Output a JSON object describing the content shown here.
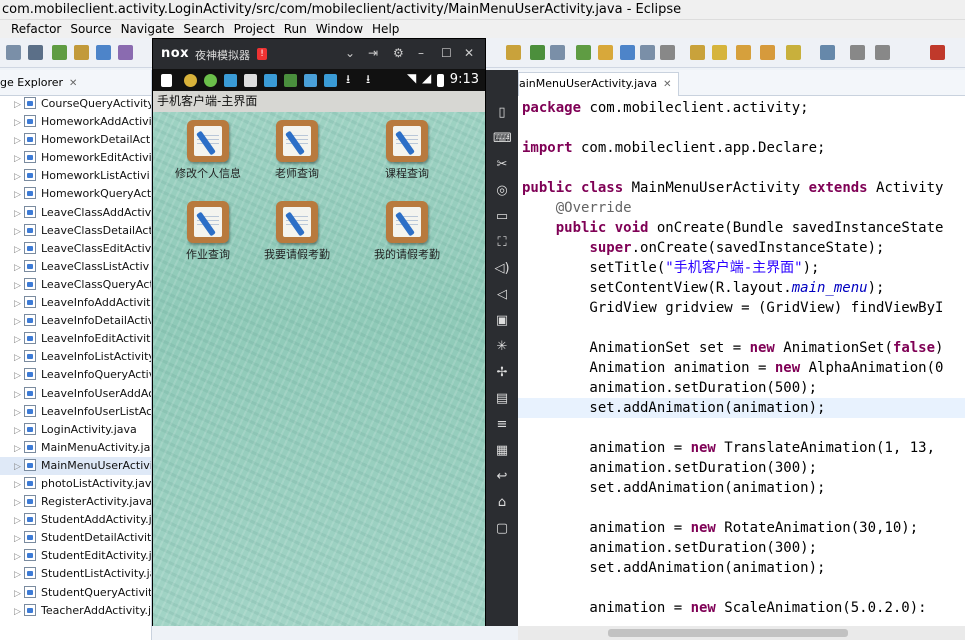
{
  "window": {
    "title": "com.mobileclient.activity.LoginActivity/src/com/mobileclient/activity/MainMenuUserActivity.java - Eclipse"
  },
  "menu": [
    "Refactor",
    "Source",
    "Navigate",
    "Search",
    "Project",
    "Run",
    "Window",
    "Help"
  ],
  "package_explorer": {
    "tab_label": "ge Explorer",
    "items": [
      "CourseQueryActivity.j",
      "HomeworkAddActivi",
      "HomeworkDetailActi",
      "HomeworkEditActivi",
      "HomeworkListActivi",
      "HomeworkQueryAct",
      "LeaveClassAddActiv",
      "LeaveClassDetailActi",
      "LeaveClassEditActiv",
      "LeaveClassListActiv",
      "LeaveClassQueryActi",
      "LeaveInfoAddActivit",
      "LeaveInfoDetailActiv",
      "LeaveInfoEditActivit",
      "LeaveInfoListActivity.",
      "LeaveInfoQueryActiv",
      "LeaveInfoUserAddAc",
      "LeaveInfoUserListAct",
      "LoginActivity.java",
      "MainMenuActivity.jav",
      "MainMenuUserActivi",
      "photoListActivity.java",
      "RegisterActivity.java",
      "StudentAddActivity.ja",
      "StudentDetailActivity.",
      "StudentEditActivity.ja",
      "StudentListActivity.jav",
      "StudentQueryActivity.",
      "TeacherAddActivity.ja"
    ],
    "selected_index": 20
  },
  "emulator": {
    "logo": "nox",
    "title": "夜神模拟器",
    "badge": "!",
    "controls": {
      "dropdown": "⌄",
      "pin": "⇥",
      "settings": "⚙",
      "minimize": "–",
      "maximize": "☐",
      "close": "✕"
    },
    "status_time": "9:13",
    "app_title": "手机客户端-主界面",
    "grid": [
      {
        "label": "修改个人信息"
      },
      {
        "label": "老师查询"
      },
      {
        "label": "课程查询"
      },
      {
        "label": "作业查询"
      },
      {
        "label": "我要请假考勤"
      },
      {
        "label": "我的请假考勤"
      }
    ]
  },
  "side_toolbar": [
    "phone-icon",
    "keyboard-icon",
    "cut-icon",
    "location-icon",
    "screen-icon",
    "fullscreen-icon",
    "volume-up-icon",
    "volume-down-icon",
    "apk-icon",
    "loading-icon",
    "shake-icon",
    "multi-icon",
    "more-icon",
    "macro-icon",
    "back-icon",
    "home-icon",
    "recent-icon"
  ],
  "editor": {
    "tab_label": "ainMenuUserActivity.java",
    "code": [
      [
        [
          "kw",
          "package"
        ],
        [
          "t",
          " com.mobileclient.activity;"
        ]
      ],
      [],
      [
        [
          "kw",
          "import"
        ],
        [
          "t",
          " com.mobileclient.app.Declare;"
        ]
      ],
      [],
      [
        [
          "kw",
          "public"
        ],
        [
          "t",
          " "
        ],
        [
          "kw",
          "class"
        ],
        [
          "t",
          " MainMenuUserActivity "
        ],
        [
          "kw",
          "extends"
        ],
        [
          "t",
          " Activity"
        ]
      ],
      [
        [
          "t",
          "    "
        ],
        [
          "ann",
          "@Override"
        ]
      ],
      [
        [
          "t",
          "    "
        ],
        [
          "kw",
          "public"
        ],
        [
          "t",
          " "
        ],
        [
          "kw",
          "void"
        ],
        [
          "t",
          " onCreate(Bundle savedInstanceState"
        ]
      ],
      [
        [
          "t",
          "        "
        ],
        [
          "kw",
          "super"
        ],
        [
          "t",
          ".onCreate(savedInstanceState);"
        ]
      ],
      [
        [
          "t",
          "        setTitle("
        ],
        [
          "str",
          "\"手机客户端-主界面\""
        ],
        [
          "t",
          ");"
        ]
      ],
      [
        [
          "t",
          "        setContentView(R.layout."
        ],
        [
          "fld",
          "main_menu"
        ],
        [
          "t",
          ");"
        ]
      ],
      [
        [
          "t",
          "        GridView gridview = (GridView) findViewByI"
        ]
      ],
      [],
      [
        [
          "t",
          "        AnimationSet set = "
        ],
        [
          "kw",
          "new"
        ],
        [
          "t",
          " AnimationSet("
        ],
        [
          "kw",
          "false"
        ],
        [
          "t",
          ")"
        ]
      ],
      [
        [
          "t",
          "        Animation animation = "
        ],
        [
          "kw",
          "new"
        ],
        [
          "t",
          " AlphaAnimation(0"
        ]
      ],
      [
        [
          "t",
          "        animation.setDuration(500);"
        ]
      ],
      [
        [
          "t",
          "        set.addAnimation(animation);"
        ]
      ],
      [],
      [
        [
          "t",
          "        animation = "
        ],
        [
          "kw",
          "new"
        ],
        [
          "t",
          " TranslateAnimation(1, 13,"
        ]
      ],
      [
        [
          "t",
          "        animation.setDuration(300);"
        ]
      ],
      [
        [
          "t",
          "        set.addAnimation(animation);"
        ]
      ],
      [],
      [
        [
          "t",
          "        animation = "
        ],
        [
          "kw",
          "new"
        ],
        [
          "t",
          " RotateAnimation(30,10);"
        ]
      ],
      [
        [
          "t",
          "        animation.setDuration(300);"
        ]
      ],
      [
        [
          "t",
          "        set.addAnimation(animation);"
        ]
      ],
      [],
      [
        [
          "t",
          "        animation = "
        ],
        [
          "kw",
          "new"
        ],
        [
          "t",
          " ScaleAnimation(5.0.2.0):"
        ]
      ]
    ],
    "highlight_line": 15
  }
}
